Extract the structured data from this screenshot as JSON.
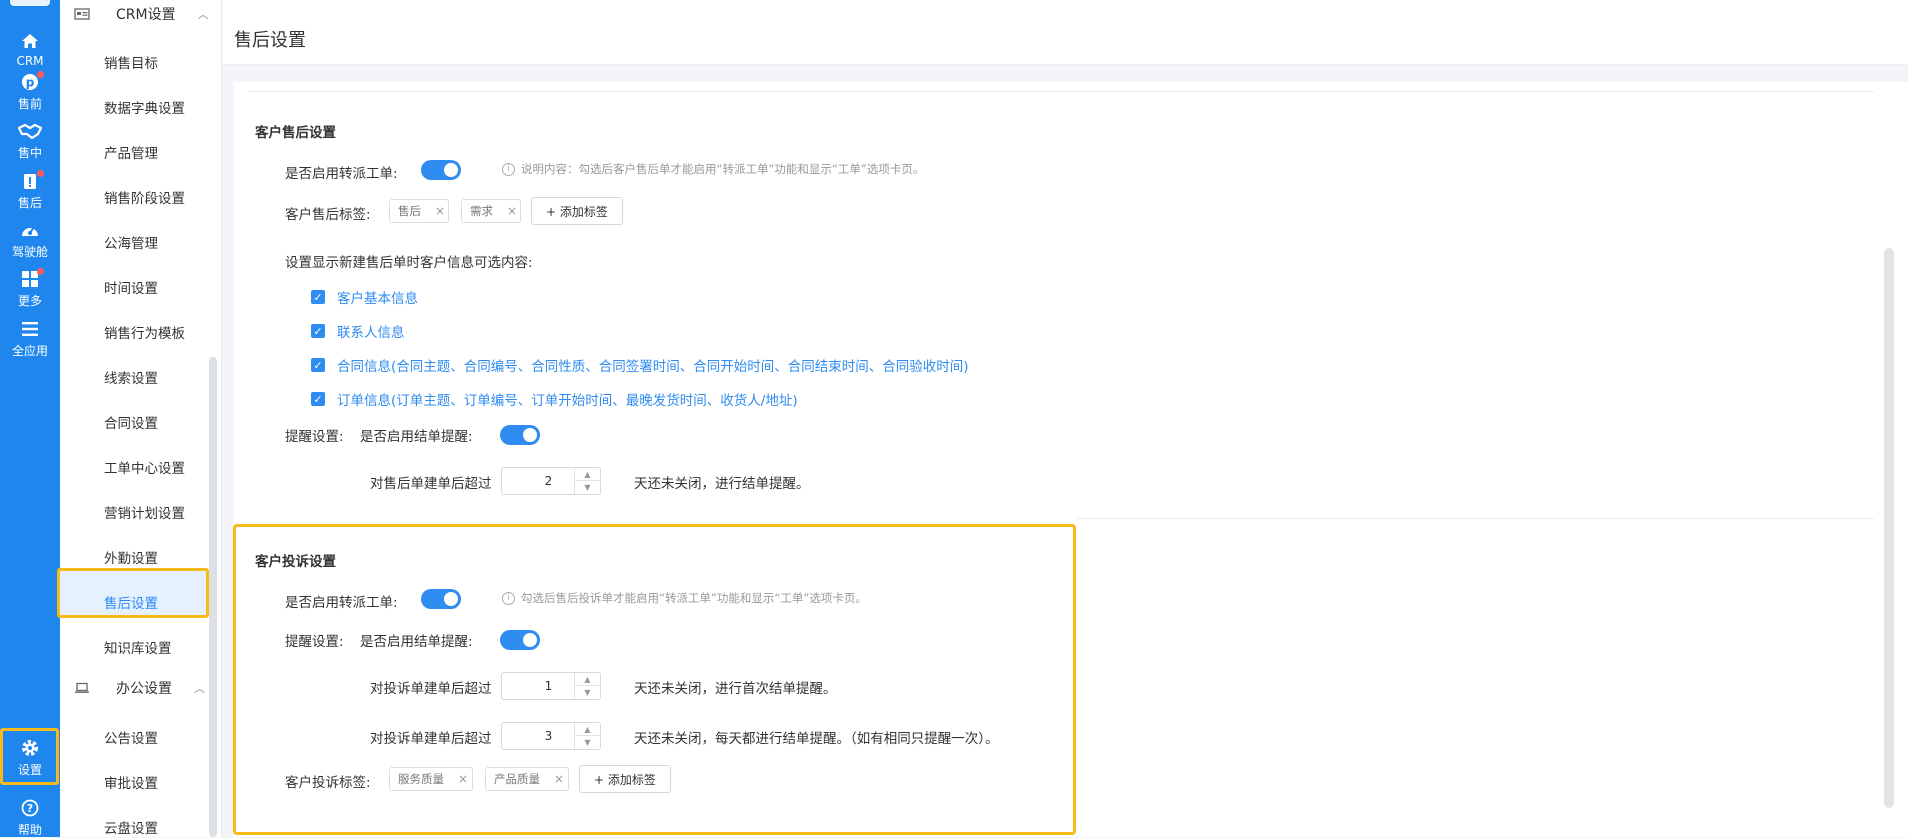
{
  "rail": {
    "items": [
      {
        "label": "CRM",
        "icon": "home-icon",
        "dot": false
      },
      {
        "label": "售前",
        "icon": "pinterest-icon",
        "dot": true
      },
      {
        "label": "售中",
        "icon": "handshake-icon",
        "dot": false
      },
      {
        "label": "售后",
        "icon": "clipboard-icon",
        "dot": true
      },
      {
        "label": "驾驶舱",
        "icon": "dashboard-icon",
        "dot": false
      },
      {
        "label": "更多",
        "icon": "grid-icon",
        "dot": true
      },
      {
        "label": "全应用",
        "icon": "menu-icon",
        "dot": false
      },
      {
        "label": "设置",
        "icon": "gear-icon",
        "dot": false
      },
      {
        "label": "帮助",
        "icon": "help-icon",
        "dot": false
      }
    ]
  },
  "submenu": {
    "crm_group": "CRM设置",
    "crm_items": [
      "销售目标",
      "数据字典设置",
      "产品管理",
      "销售阶段设置",
      "公海管理",
      "时间设置",
      "销售行为模板",
      "线索设置",
      "合同设置",
      "工单中心设置",
      "营销计划设置",
      "外勤设置",
      "售后设置",
      "知识库设置"
    ],
    "office_group": "办公设置",
    "office_items": [
      "公告设置",
      "审批设置",
      "云盘设置"
    ],
    "active": "售后设置"
  },
  "page": {
    "title": "售后设置"
  },
  "aftersale": {
    "section_title": "客户售后设置",
    "transfer_label": "是否启用转派工单:",
    "transfer_on": true,
    "transfer_hint": "说明内容：勾选后客户售后单才能启用“转派工单”功能和显示“工单”选项卡页。",
    "tags_label": "客户售后标签:",
    "tags": [
      "售后",
      "需求"
    ],
    "add_tag": "+ 添加标签",
    "display_label": "设置显示新建售后单时客户信息可选内容:",
    "options": [
      "客户基本信息",
      "联系人信息",
      "合同信息(合同主题、合同编号、合同性质、合同签署时间、合同开始时间、合同结束时间、合同验收时间)",
      "订单信息(订单主题、订单编号、订单开始时间、最晚发货时间、收货人/地址)"
    ],
    "remind_label": "提醒设置:",
    "remind_switch_label": "是否启用结单提醒:",
    "remind_on": true,
    "days_prefix": "对售后单建单后超过",
    "days_value": "2",
    "days_suffix": "天还未关闭，进行结单提醒。"
  },
  "complaint": {
    "section_title": "客户投诉设置",
    "transfer_label": "是否启用转派工单:",
    "transfer_on": true,
    "transfer_hint": "勾选后售后投诉单才能启用“转派工单”功能和显示“工单”选项卡页。",
    "remind_label": "提醒设置:",
    "remind_switch_label": "是否启用结单提醒:",
    "remind_on": true,
    "first_prefix": "对投诉单建单后超过",
    "first_value": "1",
    "first_suffix": "天还未关闭，进行首次结单提醒。",
    "daily_prefix": "对投诉单建单后超过",
    "daily_value": "3",
    "daily_suffix": "天还未关闭，每天都进行结单提醒。（如有相同只提醒一次）。",
    "tags_label": "客户投诉标签:",
    "tags": [
      "服务质量",
      "产品质量"
    ],
    "add_tag": "+ 添加标签"
  },
  "colors": {
    "rail": "#1f86ee",
    "accent": "#2f8cf0",
    "highlight": "#f7bb19",
    "badge": "#ff5a5a"
  }
}
